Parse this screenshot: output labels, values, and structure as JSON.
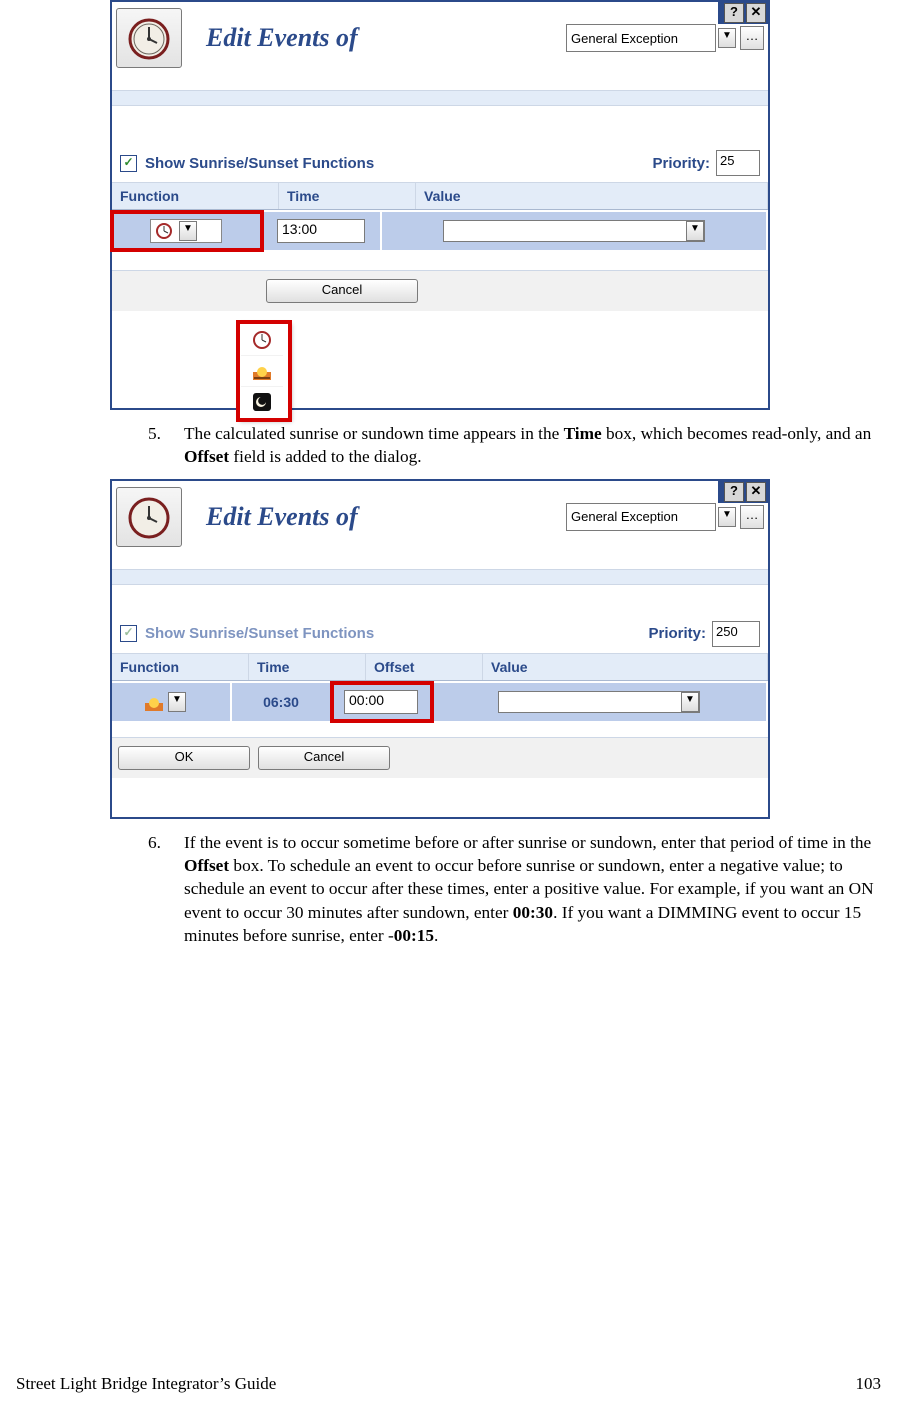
{
  "fig1": {
    "title": "Edit Events of",
    "exception_type": "General Exception",
    "show_sunrise_label": "Show Sunrise/Sunset Functions",
    "show_sunrise_checked": true,
    "priority_label": "Priority:",
    "priority_value": "25",
    "columns": {
      "function": "Function",
      "time": "Time",
      "value": "Value"
    },
    "row": {
      "time": "13:00"
    },
    "cancel_label": "Cancel"
  },
  "fig2": {
    "title": "Edit Events of",
    "exception_type": "General Exception",
    "show_sunrise_label": "Show Sunrise/Sunset Functions",
    "show_sunrise_checked": true,
    "priority_label": "Priority:",
    "priority_value": "250",
    "columns": {
      "function": "Function",
      "time": "Time",
      "offset": "Offset",
      "value": "Value"
    },
    "row": {
      "time": "06:30",
      "offset": "00:00"
    },
    "ok_label": "OK",
    "cancel_label": "Cancel"
  },
  "step5": {
    "num": "5.",
    "t1": "The calculated sunrise or sundown time appears in the ",
    "b1": "Time",
    "t2": " box, which becomes read-only, and an ",
    "b2": "Offset",
    "t3": " field is added to the dialog."
  },
  "step6": {
    "num": "6.",
    "t1": "If the event is to occur sometime before or after sunrise or sundown, enter that period of time in the ",
    "b1": "Offset",
    "t2": " box.  To schedule an event to occur before sunrise or sundown, enter a negative value; to schedule an event to occur after these times, enter a positive value.  For example, if you want an ON event to occur 30 minutes after sundown, enter ",
    "b2": "00:30",
    "t3": ".  If you want a DIMMING event to occur 15 minutes before sunrise, enter -",
    "b3": "00:15",
    "t4": "."
  },
  "footer": {
    "left": "Street Light Bridge Integrator’s Guide",
    "right": "103"
  }
}
